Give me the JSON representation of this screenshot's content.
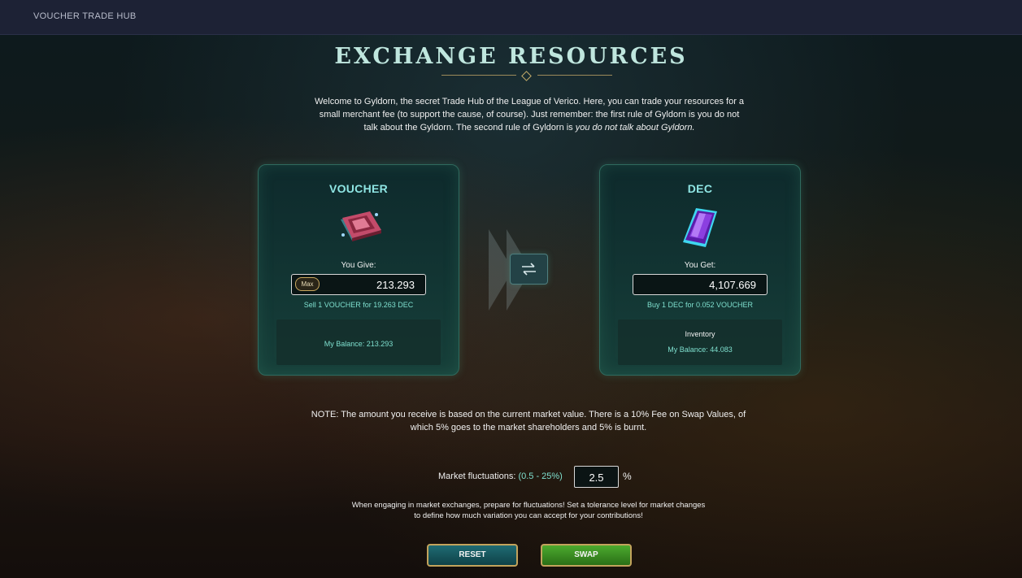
{
  "topbar": {
    "title": "VOUCHER TRADE HUB"
  },
  "page": {
    "title": "EXCHANGE RESOURCES",
    "intro_main": "Welcome to Gyldorn, the secret Trade Hub of the League of Verico. Here, you can trade your resources for a small merchant fee (to support the cause, of course). Just remember: the first rule of Gyldorn is you do not talk about the Gyldorn. The second rule of Gyldorn is ",
    "intro_em": "you do not talk about Gyldorn."
  },
  "give": {
    "title": "VOUCHER",
    "label": "You Give:",
    "max_label": "Max",
    "value": "213.293",
    "rate": "Sell 1 VOUCHER for 19.263 DEC",
    "balance": "My Balance: 213.293"
  },
  "get": {
    "title": "DEC",
    "label": "You Get:",
    "value": "4,107.669",
    "rate": "Buy 1 DEC for 0.052 VOUCHER",
    "inventory": "Inventory",
    "balance": "My Balance: 44.083"
  },
  "note": "NOTE: The amount you receive is based on the current market value. There is a 10% Fee on Swap Values, of which 5% goes to the market shareholders and 5% is burnt.",
  "fluctuation": {
    "label": "Market fluctuations:",
    "range": "(0.5 - 25%)",
    "value": "2.5",
    "unit": "%"
  },
  "warning": "When engaging in market exchanges, prepare for fluctuations! Set a tolerance level for market changes to define how much variation you can accept for your contributions!",
  "buttons": {
    "reset": "RESET",
    "swap": "SWAP"
  },
  "icons": {
    "swap_direction": "swap-arrows-icon",
    "voucher": "voucher-icon",
    "dec": "dec-crystal-icon"
  },
  "colors": {
    "accent_teal": "#7fe0cf",
    "title_teal": "#8fe6e4",
    "gold_border": "#c2a35c",
    "swap_green": "#4caa2e",
    "reset_teal": "#1f6b73"
  }
}
